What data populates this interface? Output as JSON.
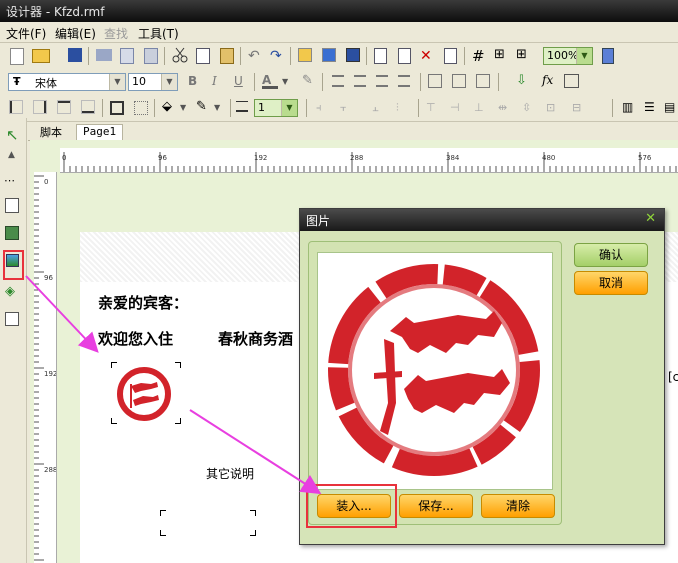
{
  "window": {
    "title": "设计器 - Kfzd.rmf"
  },
  "menu": [
    {
      "label": "文件(F)"
    },
    {
      "label": "编辑(E)"
    },
    {
      "label": "查找"
    },
    {
      "label": "工具(T)"
    }
  ],
  "toolbar": {
    "zoom": "100%",
    "font_name": "宋体",
    "font_size": "10",
    "line_width": "1",
    "fx_label": "fx"
  },
  "tabs": [
    {
      "label": "脚本"
    },
    {
      "label": "Page1"
    }
  ],
  "ruler": {
    "h_ticks": [
      "0",
      "96",
      "192",
      "288",
      "384",
      "480",
      "576"
    ],
    "v_ticks": [
      "0",
      "96",
      "192",
      "288"
    ]
  },
  "page": {
    "greeting": "亲爱的宾客：",
    "welcome_1": "欢迎您入住",
    "welcome_2": "春秋商务酒",
    "other_note": "其它说明",
    "right_field": "[c"
  },
  "dialog": {
    "title": "图片",
    "confirm": "确认",
    "cancel": "取消",
    "load": "装入...",
    "save": "保存...",
    "clear": "清除"
  },
  "colors": {
    "seal_red": "#d2232a",
    "highlight": "#e8323c",
    "arrow": "#e83fe0",
    "dialog_bg": "#d6e4b8",
    "orange_button": "#ffb000",
    "green_button": "#b9dc8e"
  }
}
